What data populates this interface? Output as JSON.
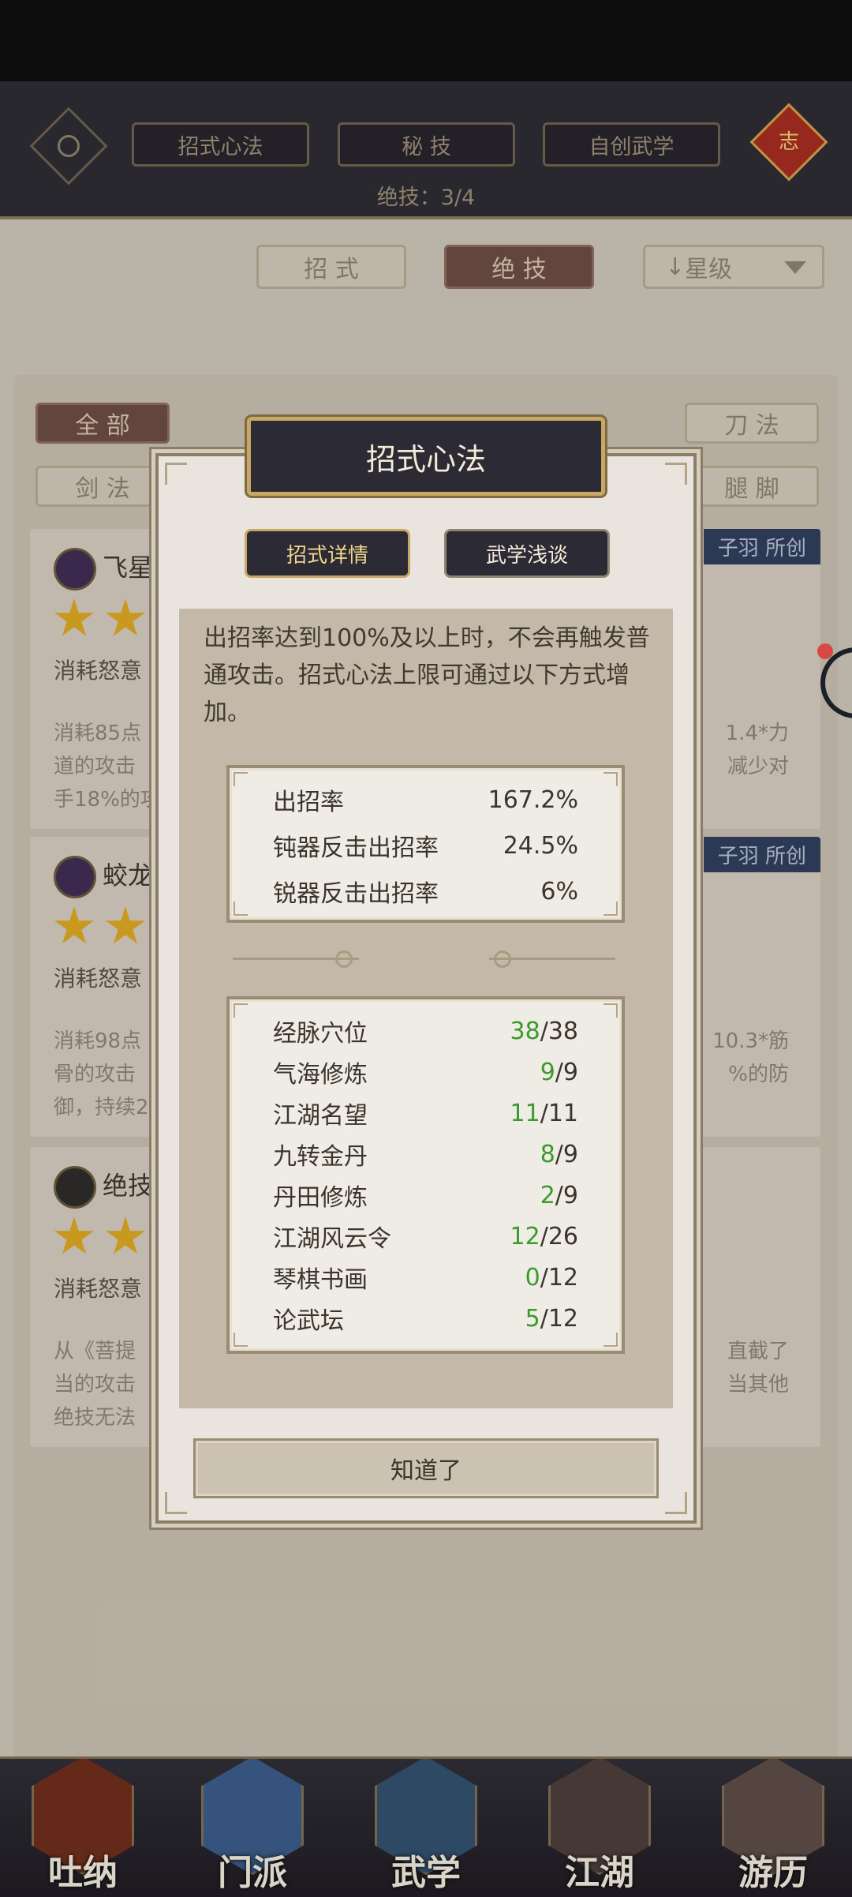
{
  "topbar": {
    "tabs": [
      "招式心法",
      "秘 技",
      "自创武学"
    ],
    "ultimate_count": "绝技：3/4",
    "knot_label": "志"
  },
  "filters": {
    "moves": "招 式",
    "ultimates": "绝 技",
    "sort": "星级",
    "sort_arrow": "↓"
  },
  "categories": [
    "全 部",
    "剑 法",
    "刀 法",
    "腿 脚"
  ],
  "cards": [
    {
      "name": "飞星",
      "cost": "消耗怒意",
      "lines": [
        "消耗85点",
        "道的攻击",
        "手18%的攻"
      ],
      "tag": "子羽 所创",
      "right_lines": [
        "1.4*力",
        "减少对"
      ]
    },
    {
      "name": "蛟龙",
      "cost": "消耗怒意",
      "lines": [
        "消耗98点",
        "骨的攻击",
        "御，持续2"
      ],
      "tag": "子羽 所创",
      "right_lines": [
        "10.3*筋",
        "%的防"
      ]
    },
    {
      "name": "绝技",
      "cost": "消耗怒意",
      "lines": [
        "从《菩提",
        "当的攻击",
        "绝技无法"
      ],
      "tag": "",
      "right_lines": [
        "直截了",
        "当其他"
      ]
    }
  ],
  "bottom_nav": [
    "吐纳",
    "门派",
    "武学",
    "江湖",
    "游历"
  ],
  "modal": {
    "title": "招式心法",
    "tabs": {
      "active": "招式详情",
      "inactive": "武学浅谈"
    },
    "description": "出招率达到100%及以上时，不会再触发普通攻击。招式心法上限可通过以下方式增加。",
    "rates": [
      {
        "label": "出招率",
        "value": "167.2%"
      },
      {
        "label": "钝器反击出招率",
        "value": "24.5%"
      },
      {
        "label": "锐器反击出招率",
        "value": "6%"
      }
    ],
    "sources": [
      {
        "label": "经脉穴位",
        "current": "38",
        "max": "/38"
      },
      {
        "label": "气海修炼",
        "current": "9",
        "max": "/9"
      },
      {
        "label": "江湖名望",
        "current": "11",
        "max": "/11"
      },
      {
        "label": "九转金丹",
        "current": "8",
        "max": "/9"
      },
      {
        "label": "丹田修炼",
        "current": "2",
        "max": "/9"
      },
      {
        "label": "江湖风云令",
        "current": "12",
        "max": "/26"
      },
      {
        "label": "琴棋书画",
        "current": "0",
        "max": "/12"
      },
      {
        "label": "论武坛",
        "current": "5",
        "max": "/12"
      }
    ],
    "confirm": "知道了"
  },
  "colors": {
    "progress_green": "#3a9a2c",
    "modal_header": "#2b2a35",
    "accent_gold": "#c6a864"
  }
}
